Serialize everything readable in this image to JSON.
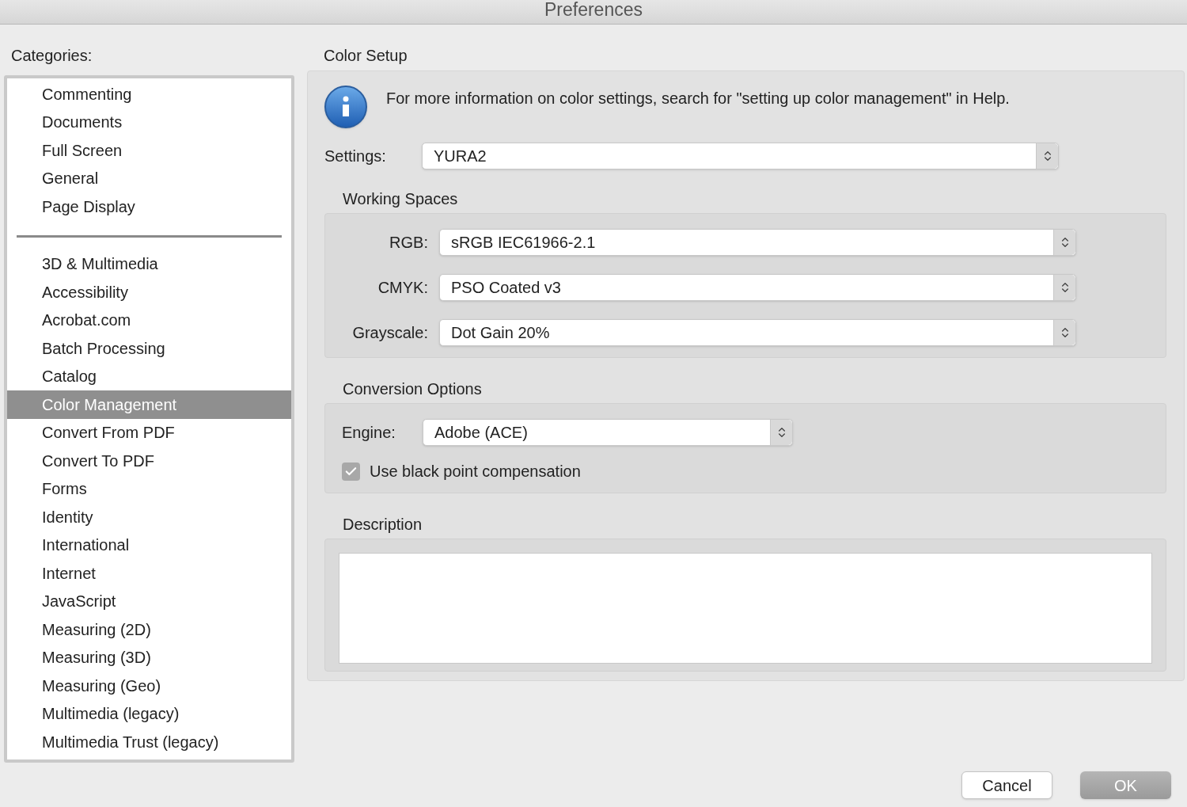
{
  "window": {
    "title": "Preferences"
  },
  "categories": {
    "label": "Categories:",
    "groups": [
      {
        "items": [
          {
            "label": "Commenting",
            "selected": false
          },
          {
            "label": "Documents",
            "selected": false
          },
          {
            "label": "Full Screen",
            "selected": false
          },
          {
            "label": "General",
            "selected": false
          },
          {
            "label": "Page Display",
            "selected": false
          }
        ]
      },
      {
        "items": [
          {
            "label": "3D & Multimedia",
            "selected": false
          },
          {
            "label": "Accessibility",
            "selected": false
          },
          {
            "label": "Acrobat.com",
            "selected": false
          },
          {
            "label": "Batch Processing",
            "selected": false
          },
          {
            "label": "Catalog",
            "selected": false
          },
          {
            "label": "Color Management",
            "selected": true
          },
          {
            "label": "Convert From PDF",
            "selected": false
          },
          {
            "label": "Convert To PDF",
            "selected": false
          },
          {
            "label": "Forms",
            "selected": false
          },
          {
            "label": "Identity",
            "selected": false
          },
          {
            "label": "International",
            "selected": false
          },
          {
            "label": "Internet",
            "selected": false
          },
          {
            "label": "JavaScript",
            "selected": false
          },
          {
            "label": "Measuring (2D)",
            "selected": false
          },
          {
            "label": "Measuring (3D)",
            "selected": false
          },
          {
            "label": "Measuring (Geo)",
            "selected": false
          },
          {
            "label": "Multimedia (legacy)",
            "selected": false
          },
          {
            "label": "Multimedia Trust (legacy)",
            "selected": false
          }
        ]
      }
    ]
  },
  "color_setup": {
    "title": "Color Setup",
    "info": "For more information on color settings, search for \"setting up color management\" in Help.",
    "settings": {
      "label": "Settings:",
      "value": "YURA2"
    },
    "working_spaces": {
      "title": "Working Spaces",
      "rows": [
        {
          "label": "RGB:",
          "value": "sRGB IEC61966-2.1"
        },
        {
          "label": "CMYK:",
          "value": "PSO Coated v3"
        },
        {
          "label": "Grayscale:",
          "value": "Dot Gain 20%"
        }
      ]
    },
    "conversion": {
      "title": "Conversion Options",
      "engine": {
        "label": "Engine:",
        "value": "Adobe (ACE)"
      },
      "black_point": {
        "label": "Use black point compensation",
        "checked": true
      }
    },
    "description": {
      "title": "Description"
    }
  },
  "buttons": [
    {
      "label": "Cancel",
      "kind": "secondary"
    },
    {
      "label": "OK",
      "kind": "default"
    }
  ]
}
